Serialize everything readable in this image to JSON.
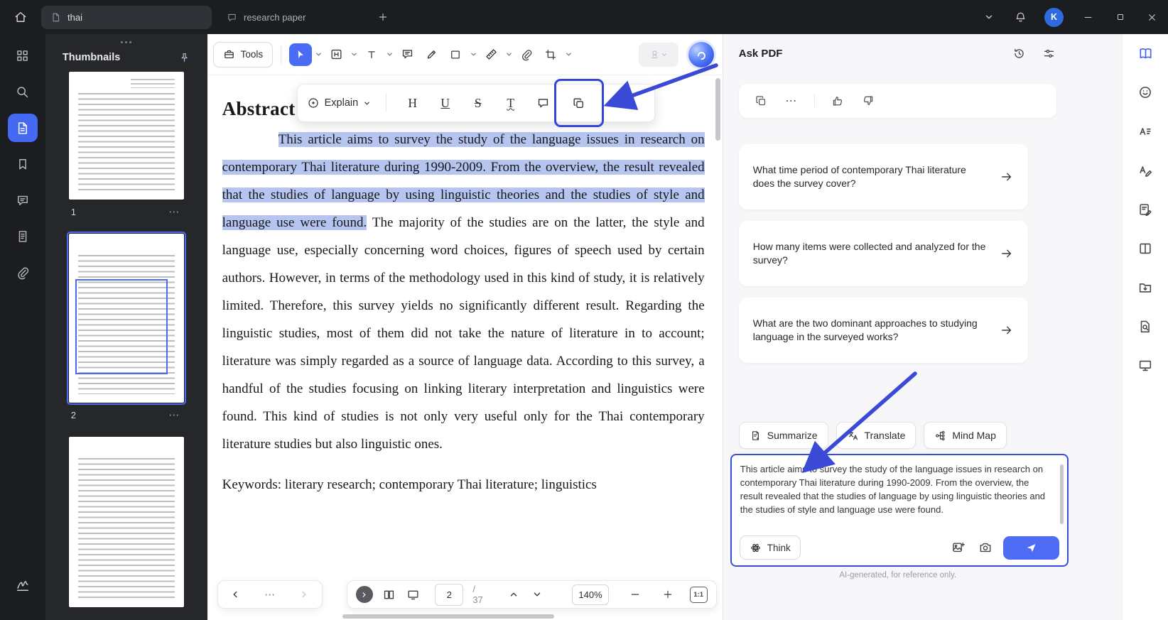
{
  "titlebar": {
    "tabs": [
      {
        "label": "thai"
      },
      {
        "label": "research paper"
      }
    ],
    "avatar_initial": "K"
  },
  "thumbnails": {
    "title": "Thumbnails",
    "pages": [
      {
        "number": "1"
      },
      {
        "number": "2"
      }
    ]
  },
  "icons": {
    "more_glyph": "⋯"
  },
  "main_toolbar": {
    "tools_label": "Tools"
  },
  "selection_toolbar": {
    "explain_label": "Explain",
    "highlight_glyph": "H",
    "underline_glyph": "U",
    "strikethrough_glyph": "S",
    "squiggly_glyph": "T"
  },
  "document": {
    "heading": "Abstract",
    "highlighted_text": "This article aims to survey the study of the language issues in research on contemporary Thai literature during 1990-2009. From the overview, the result revealed that the studies of language by using linguistic theories and the studies of style and language use were found.",
    "body_text": " The majority of the studies are on the latter, the style and language use, especially concerning word choices, figures of speech used by certain authors. However, in terms of the methodology used in this kind of study, it is relatively limited. Therefore, this survey yields no significantly different result. Regarding the linguistic studies, most of them did not take the nature of literature in to account; literature was simply regarded as a source of language data. According to this survey, a handful of the studies focusing on linking literary interpretation and linguistics were found. This kind of studies is not only very useful only for the Thai contemporary literature studies but also linguistic ones.",
    "keywords": "Keywords: literary research; contemporary Thai literature; linguistics"
  },
  "bottom_bar": {
    "current_page": "2",
    "total_pages": "/ 37",
    "zoom_level": "140%",
    "fit_label": "1:1"
  },
  "ask_pdf": {
    "title": "Ask PDF",
    "suggested_questions": [
      {
        "text": "What time period of contemporary Thai literature does the survey cover?"
      },
      {
        "text": "How many items were collected and analyzed for the survey?"
      },
      {
        "text": "What are the two dominant approaches to studying language in the surveyed works?"
      }
    ],
    "action_buttons": [
      {
        "label": "Summarize"
      },
      {
        "label": "Translate"
      },
      {
        "label": "Mind Map"
      }
    ],
    "input_text": "This article aims to survey the study of the language issues in research on contemporary Thai literature during 1990-2009. From the overview, the result revealed that the studies of language by using linguistic theories and the studies of style and language use were found.",
    "think_label": "Think",
    "disclaimer": "AI-generated, for reference only."
  },
  "colors": {
    "accent_blue": "#3a49d6",
    "button_blue": "#4e6bf6",
    "selection_highlight": "#b6c4f0"
  }
}
